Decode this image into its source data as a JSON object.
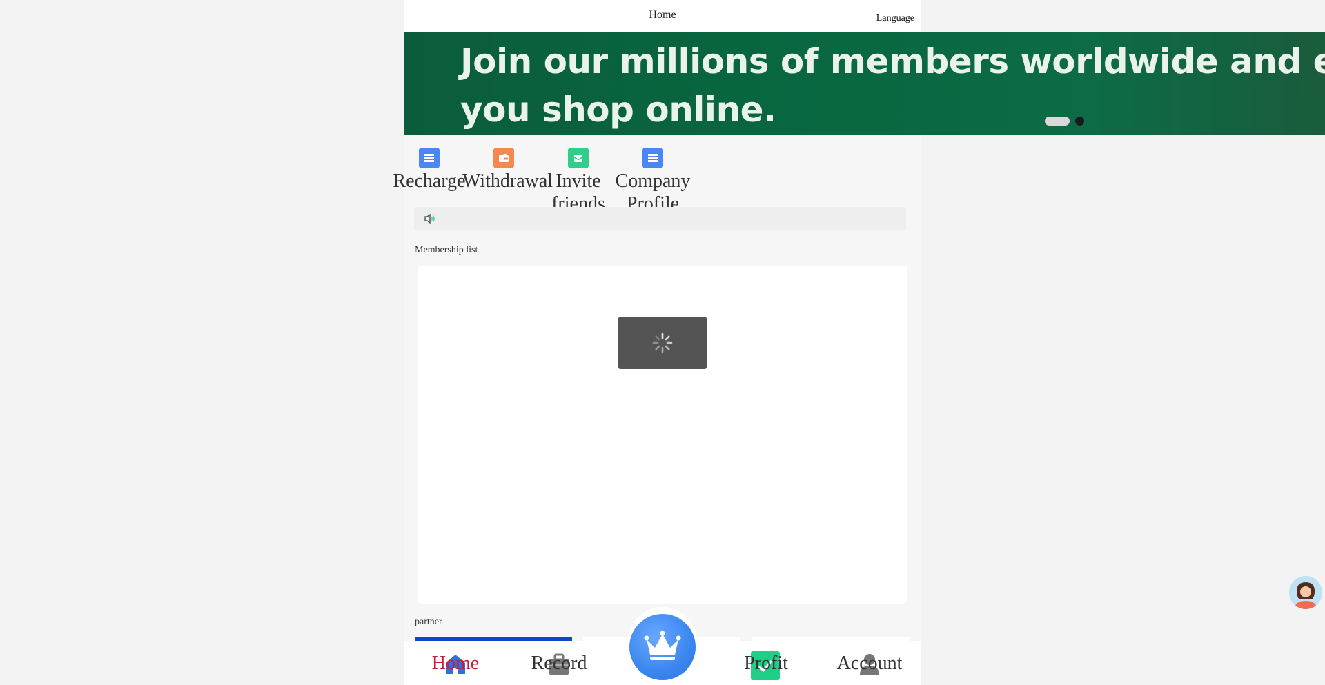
{
  "header": {
    "title": "Home",
    "language_label": "Language"
  },
  "banner": {
    "line1": "Join our millions of members worldwide and earn m",
    "line2": "you shop online.",
    "slides": 2,
    "active_slide": 1
  },
  "quick_actions": [
    {
      "label": "Recharge",
      "icon": "recharge-icon",
      "color": "#4a86f7"
    },
    {
      "label": "Withdrawal",
      "icon": "wallet-icon",
      "color": "#f5874f"
    },
    {
      "label": "Invite friends",
      "icon": "invite-icon",
      "color": "#2ecf8a"
    },
    {
      "label": "Company Profile",
      "icon": "profile-icon",
      "color": "#4a86f7"
    }
  ],
  "notice": {
    "icon": "speaker-icon",
    "text": ""
  },
  "membership": {
    "title": "Membership list",
    "loading": true
  },
  "partner": {
    "title": "partner"
  },
  "nav": [
    {
      "label": "Home",
      "icon": "home-icon",
      "active": true,
      "color": "#c0203c"
    },
    {
      "label": "Record",
      "icon": "briefcase-icon",
      "active": false
    },
    {
      "label": "",
      "icon": "crown-icon",
      "active": false
    },
    {
      "label": "Profit",
      "icon": "profit-icon",
      "active": false
    },
    {
      "label": "Account",
      "icon": "user-icon",
      "active": false
    }
  ],
  "colors": {
    "banner_green": "#08673f",
    "accent_blue": "#3a86f0",
    "active_red": "#c0203c"
  }
}
